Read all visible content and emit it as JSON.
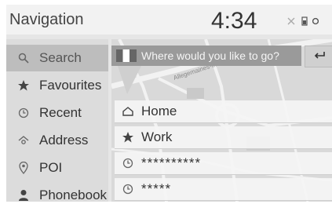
{
  "header": {
    "title": "Navigation",
    "time": "4:34",
    "status_icons": [
      "bluetooth-off-icon",
      "phone-battery-icon",
      "signal-icon"
    ]
  },
  "sidebar": {
    "items": [
      {
        "label": "Search",
        "icon": "search-icon",
        "active": true
      },
      {
        "label": "Favourites",
        "icon": "star-icon"
      },
      {
        "label": "Recent",
        "icon": "clock-icon"
      },
      {
        "label": "Address",
        "icon": "address-icon"
      },
      {
        "label": "POI",
        "icon": "location-pin-icon"
      },
      {
        "label": "Phonebook",
        "icon": "person-icon"
      }
    ]
  },
  "search": {
    "placeholder": "Where would you like to go?",
    "back_icon": "back-arrow-icon"
  },
  "map": {
    "street_label": "Allegemaines-Industrie"
  },
  "quick_list": [
    {
      "label": "Home",
      "icon": "home-icon"
    },
    {
      "label": "Work",
      "icon": "star-icon"
    },
    {
      "label": "**********",
      "icon": "clock-icon"
    },
    {
      "label": "*****",
      "icon": "clock-icon"
    }
  ]
}
